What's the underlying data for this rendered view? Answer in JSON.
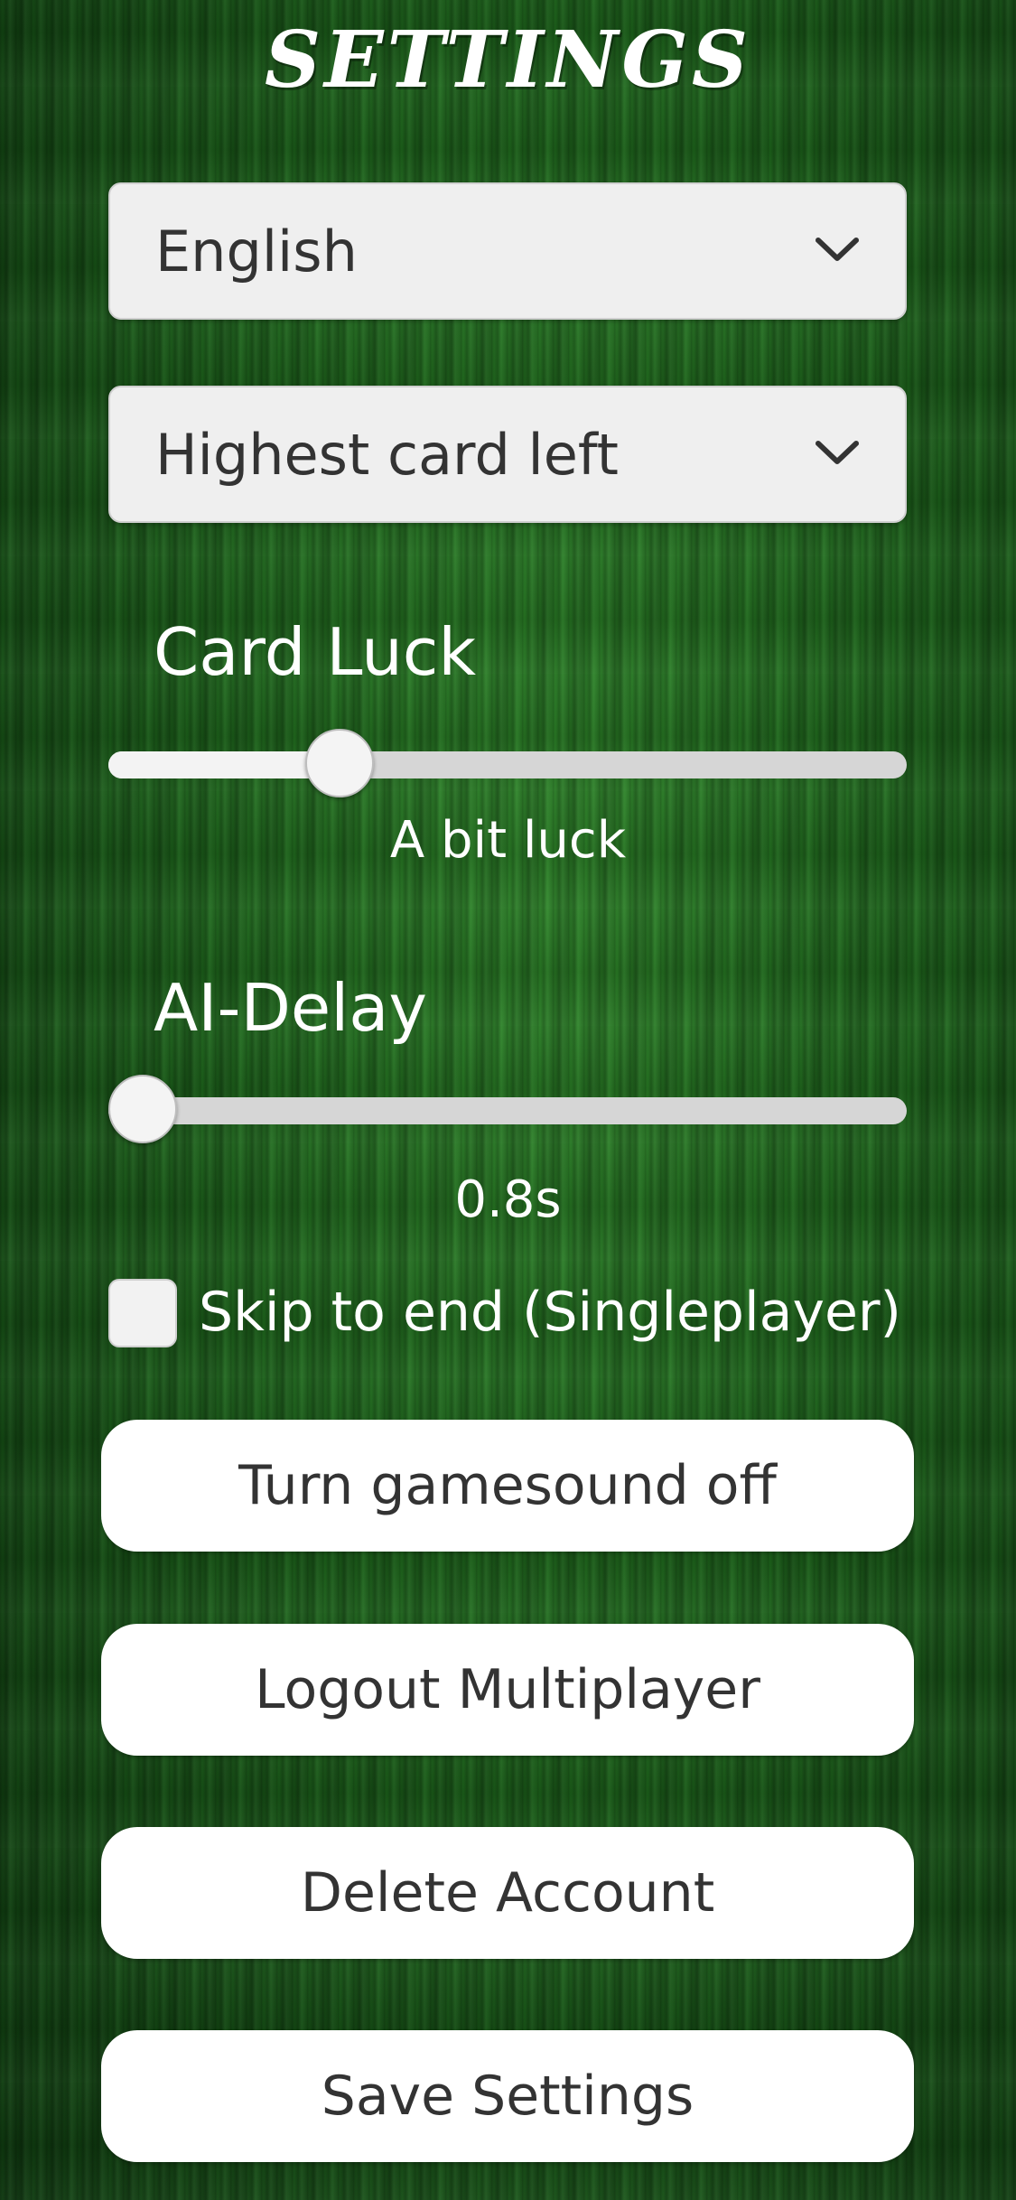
{
  "header": {
    "title": "SETTINGS"
  },
  "language_select": {
    "value": "English",
    "icon": "chevron-down-icon"
  },
  "mode_select": {
    "value": "Highest card left",
    "icon": "chevron-down-icon"
  },
  "card_luck": {
    "label": "Card Luck",
    "value_text": "A bit luck",
    "fraction": 0.27
  },
  "ai_delay": {
    "label": "AI-Delay",
    "value_text": "0.8s",
    "fraction": 0.0
  },
  "skip_to_end": {
    "label": "Skip to end (Singleplayer)",
    "checked": false
  },
  "buttons": {
    "sound": "Turn gamesound off",
    "logout": "Logout Multiplayer",
    "delete": "Delete Account",
    "save": "Save Settings"
  },
  "colors": {
    "background_green": "#1f6a1f",
    "button_bg": "#ffffff",
    "text_dark": "#333333"
  }
}
